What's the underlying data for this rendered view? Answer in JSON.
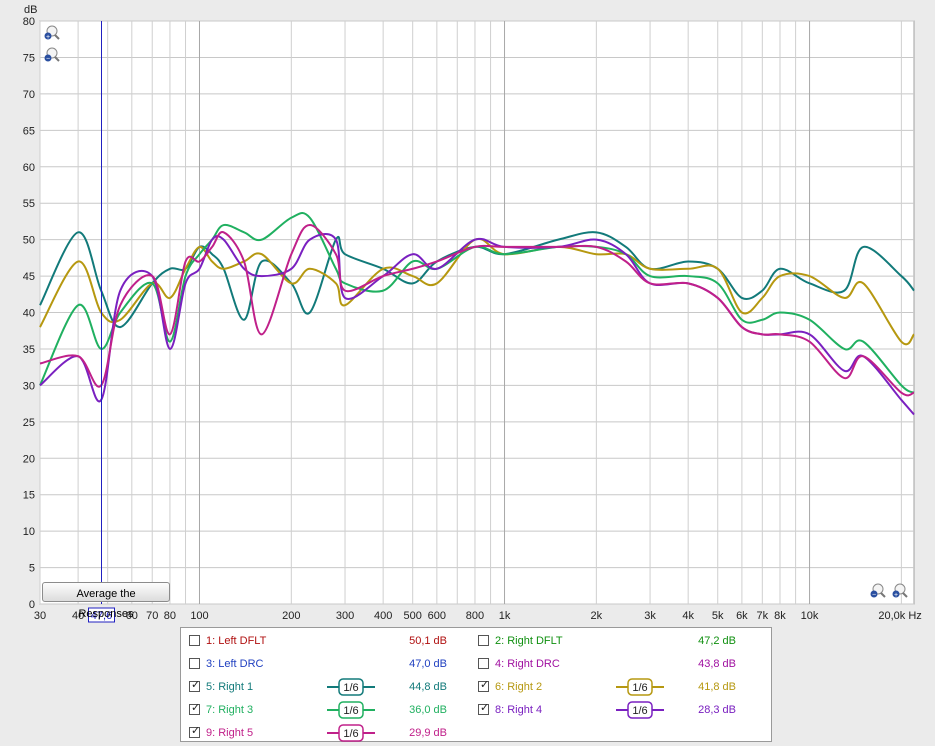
{
  "chart_data": {
    "type": "line",
    "xscale": "log",
    "xlim": [
      30,
      22000
    ],
    "ylim": [
      0,
      80
    ],
    "ylabel": "dB",
    "xlabel": "Hz",
    "grid": true,
    "y_ticks": [
      "0",
      "5",
      "10",
      "15",
      "20",
      "25",
      "30",
      "35",
      "40",
      "45",
      "50",
      "55",
      "60",
      "65",
      "70",
      "75",
      "80"
    ],
    "x_ticks": [
      {
        "v": 30,
        "label": "30"
      },
      {
        "v": 40,
        "label": "40"
      },
      {
        "v": 60,
        "label": "60"
      },
      {
        "v": 70,
        "label": "70"
      },
      {
        "v": 80,
        "label": "80"
      },
      {
        "v": 100,
        "label": "100"
      },
      {
        "v": 200,
        "label": "200"
      },
      {
        "v": 300,
        "label": "300"
      },
      {
        "v": 400,
        "label": "400"
      },
      {
        "v": 500,
        "label": "500"
      },
      {
        "v": 600,
        "label": "600"
      },
      {
        "v": 800,
        "label": "800"
      },
      {
        "v": 1000,
        "label": "1k"
      },
      {
        "v": 2000,
        "label": "2k"
      },
      {
        "v": 3000,
        "label": "3k"
      },
      {
        "v": 4000,
        "label": "4k"
      },
      {
        "v": 5000,
        "label": "5k"
      },
      {
        "v": 6000,
        "label": "6k"
      },
      {
        "v": 7000,
        "label": "7k"
      },
      {
        "v": 8000,
        "label": "8k"
      },
      {
        "v": 10000,
        "label": "10k"
      },
      {
        "v": 20000,
        "label": "20,0k Hz"
      }
    ],
    "cursor": {
      "freq": 47.6,
      "label": "47,6"
    },
    "series": [
      {
        "name": "5: Right 1",
        "color": "#127a7a",
        "x": [
          30,
          40,
          47.6,
          55,
          70,
          80,
          90,
          100,
          110,
          120,
          140,
          160,
          200,
          230,
          280,
          300,
          400,
          500,
          600,
          800,
          1000,
          1500,
          2000,
          2500,
          3000,
          4000,
          5000,
          6000,
          7000,
          8000,
          10000,
          13000,
          15000,
          20000,
          22000
        ],
        "y": [
          41,
          51,
          43,
          38,
          44,
          46,
          46,
          49,
          48,
          46,
          39,
          47,
          44,
          40,
          50,
          48,
          46,
          44,
          47,
          49,
          48,
          50,
          51,
          49,
          46,
          47,
          46,
          42,
          43,
          46,
          44,
          43,
          49,
          45,
          43
        ]
      },
      {
        "name": "6: Right 2",
        "color": "#b69810",
        "x": [
          30,
          40,
          47.6,
          55,
          70,
          80,
          90,
          100,
          110,
          120,
          140,
          160,
          200,
          230,
          280,
          300,
          400,
          500,
          600,
          800,
          1000,
          1500,
          2000,
          2500,
          3000,
          4000,
          5000,
          6000,
          7000,
          8000,
          10000,
          13000,
          15000,
          20000,
          22000
        ],
        "y": [
          38,
          47,
          40,
          39,
          44,
          42,
          46,
          49,
          47,
          46,
          47,
          48,
          44,
          46,
          44,
          41,
          46,
          45,
          44,
          50,
          48,
          49,
          48,
          48,
          46,
          46,
          46,
          40,
          42,
          45,
          45,
          42,
          44,
          36,
          37
        ]
      },
      {
        "name": "7: Right 3",
        "color": "#20b060",
        "x": [
          30,
          40,
          47.6,
          55,
          70,
          80,
          90,
          100,
          110,
          120,
          140,
          160,
          200,
          230,
          280,
          300,
          400,
          500,
          600,
          800,
          1000,
          1500,
          2000,
          2500,
          3000,
          4000,
          5000,
          6000,
          7000,
          8000,
          10000,
          13000,
          15000,
          20000,
          22000
        ],
        "y": [
          30,
          41,
          35,
          40,
          44,
          36,
          45,
          48,
          50,
          52,
          51,
          50,
          53,
          53,
          46,
          44,
          43,
          47,
          46,
          49,
          48,
          49,
          49,
          48,
          45,
          45,
          44,
          39,
          39,
          40,
          39,
          35,
          36,
          30,
          29
        ]
      },
      {
        "name": "8: Right 4",
        "color": "#7a20c0",
        "x": [
          30,
          40,
          47.6,
          55,
          70,
          80,
          90,
          100,
          110,
          120,
          140,
          160,
          200,
          230,
          280,
          300,
          400,
          500,
          600,
          800,
          1000,
          1500,
          2000,
          2500,
          3000,
          4000,
          5000,
          6000,
          7000,
          8000,
          10000,
          13000,
          15000,
          20000,
          22000
        ],
        "y": [
          30,
          34,
          28,
          43,
          45,
          35,
          44,
          46,
          50,
          50,
          46,
          45,
          46,
          50,
          50,
          42,
          45,
          48,
          46,
          50,
          49,
          49,
          50,
          48,
          44,
          44,
          42,
          38,
          37,
          37,
          37,
          32,
          34,
          28,
          26
        ]
      },
      {
        "name": "9: Right 5",
        "color": "#c0208a",
        "x": [
          30,
          40,
          47.6,
          55,
          70,
          80,
          90,
          100,
          110,
          120,
          140,
          160,
          200,
          230,
          280,
          300,
          400,
          500,
          600,
          800,
          1000,
          1500,
          2000,
          2500,
          3000,
          4000,
          5000,
          6000,
          7000,
          8000,
          10000,
          13000,
          15000,
          20000,
          22000
        ],
        "y": [
          33,
          34,
          30,
          41,
          45,
          37,
          47,
          47,
          49,
          51,
          47,
          37,
          48,
          52,
          48,
          43,
          45,
          46,
          47,
          49,
          49,
          49,
          49,
          47,
          44,
          44,
          42,
          38,
          37,
          37,
          36,
          31,
          34,
          29,
          29
        ]
      }
    ]
  },
  "controls": {
    "average_button": "Average the Responses"
  },
  "legend": {
    "items": [
      {
        "label": "1: Left DFLT",
        "value": "50,1 dB",
        "color": "#b01010",
        "checked": false,
        "smoothing": ""
      },
      {
        "label": "2: Right DFLT",
        "value": "47,2 dB",
        "color": "#109010",
        "checked": false,
        "smoothing": ""
      },
      {
        "label": "3: Left DRC",
        "value": "47,0 dB",
        "color": "#2040c0",
        "checked": false,
        "smoothing": ""
      },
      {
        "label": "4: Right DRC",
        "value": "43,8 dB",
        "color": "#a010a0",
        "checked": false,
        "smoothing": ""
      },
      {
        "label": "5: Right 1",
        "value": "44,8 dB",
        "color": "#127a7a",
        "checked": true,
        "smoothing": "1/6"
      },
      {
        "label": "6: Right 2",
        "value": "41,8 dB",
        "color": "#b69810",
        "checked": true,
        "smoothing": "1/6"
      },
      {
        "label": "7: Right 3",
        "value": "36,0 dB",
        "color": "#20b060",
        "checked": true,
        "smoothing": "1/6"
      },
      {
        "label": "8: Right 4",
        "value": "28,3 dB",
        "color": "#7a20c0",
        "checked": true,
        "smoothing": "1/6"
      },
      {
        "label": "9: Right 5",
        "value": "29,9 dB",
        "color": "#c0208a",
        "checked": true,
        "smoothing": "1/6"
      }
    ]
  }
}
